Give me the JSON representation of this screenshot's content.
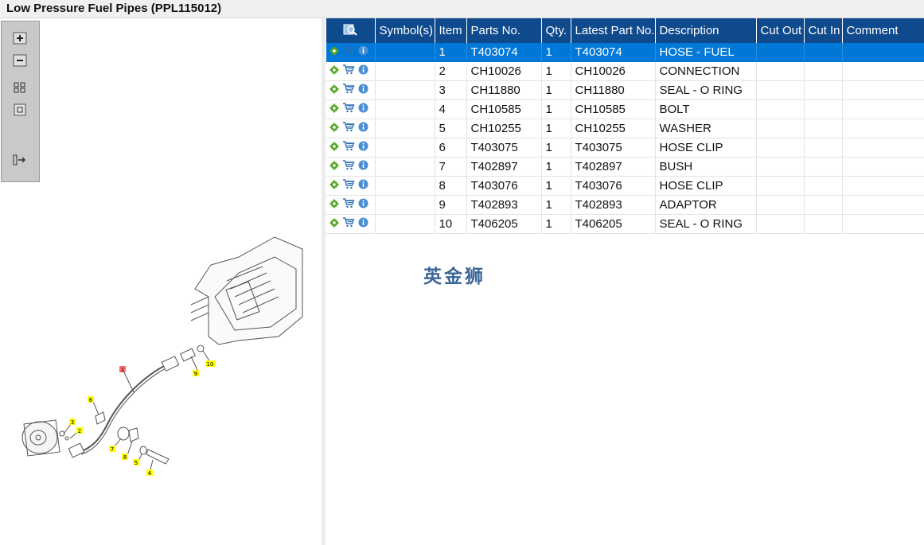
{
  "title": "Low Pressure Fuel Pipes (PPL115012)",
  "toolbar": {
    "buttons": [
      "zoom-in-icon",
      "zoom-out-icon",
      "fit-page-icon",
      "actual-size-icon",
      "export-icon"
    ]
  },
  "diagram": {
    "callouts": [
      "1",
      "2",
      "3",
      "4",
      "5",
      "6",
      "7",
      "8",
      "9",
      "10"
    ]
  },
  "table": {
    "header_icon": "search-magnifier-icon",
    "columns": [
      "Symbol(s)",
      "Item",
      "Parts No.",
      "Qty.",
      "Latest Part No.",
      "Description",
      "Cut Out",
      "Cut In",
      "Comment"
    ],
    "selected_row": 0,
    "rows": [
      {
        "symbols": "",
        "item": "1",
        "part_no": "T403074",
        "qty": "1",
        "latest": "T403074",
        "desc": "HOSE - FUEL",
        "cut_out": "",
        "cut_in": "",
        "comment": ""
      },
      {
        "symbols": "",
        "item": "2",
        "part_no": "CH10026",
        "qty": "1",
        "latest": "CH10026",
        "desc": "CONNECTION",
        "cut_out": "",
        "cut_in": "",
        "comment": ""
      },
      {
        "symbols": "",
        "item": "3",
        "part_no": "CH11880",
        "qty": "1",
        "latest": "CH11880",
        "desc": "SEAL - O RING",
        "cut_out": "",
        "cut_in": "",
        "comment": ""
      },
      {
        "symbols": "",
        "item": "4",
        "part_no": "CH10585",
        "qty": "1",
        "latest": "CH10585",
        "desc": "BOLT",
        "cut_out": "",
        "cut_in": "",
        "comment": ""
      },
      {
        "symbols": "",
        "item": "5",
        "part_no": "CH10255",
        "qty": "1",
        "latest": "CH10255",
        "desc": "WASHER",
        "cut_out": "",
        "cut_in": "",
        "comment": ""
      },
      {
        "symbols": "",
        "item": "6",
        "part_no": "T403075",
        "qty": "1",
        "latest": "T403075",
        "desc": "HOSE CLIP",
        "cut_out": "",
        "cut_in": "",
        "comment": ""
      },
      {
        "symbols": "",
        "item": "7",
        "part_no": "T402897",
        "qty": "1",
        "latest": "T402897",
        "desc": "BUSH",
        "cut_out": "",
        "cut_in": "",
        "comment": ""
      },
      {
        "symbols": "",
        "item": "8",
        "part_no": "T403076",
        "qty": "1",
        "latest": "T403076",
        "desc": "HOSE CLIP",
        "cut_out": "",
        "cut_in": "",
        "comment": ""
      },
      {
        "symbols": "",
        "item": "9",
        "part_no": "T402893",
        "qty": "1",
        "latest": "T402893",
        "desc": "ADAPTOR",
        "cut_out": "",
        "cut_in": "",
        "comment": ""
      },
      {
        "symbols": "",
        "item": "10",
        "part_no": "T406205",
        "qty": "1",
        "latest": "T406205",
        "desc": "SEAL - O RING",
        "cut_out": "",
        "cut_in": "",
        "comment": ""
      }
    ],
    "row_icons": [
      "gear-icon",
      "cart-icon",
      "info-icon"
    ]
  },
  "watermark": "英金狮",
  "colors": {
    "header_bg": "#0f4a8c",
    "selected_row": "#0078d7",
    "callout_yellow": "#ffff00",
    "callout_red": "#ff6b6b",
    "watermark": "#3a6596"
  }
}
